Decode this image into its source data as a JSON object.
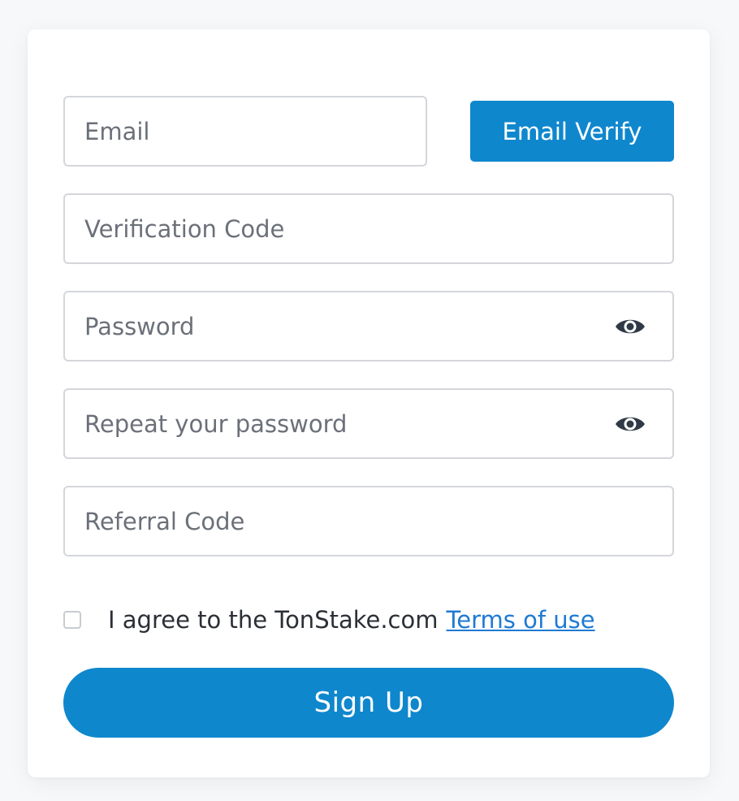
{
  "form": {
    "email": {
      "value": "",
      "placeholder": "Email"
    },
    "email_verify_label": "Email Verify",
    "verification_code": {
      "value": "",
      "placeholder": "Verification Code"
    },
    "password": {
      "value": "",
      "placeholder": "Password"
    },
    "repeat_password": {
      "value": "",
      "placeholder": "Repeat your password"
    },
    "referral_code": {
      "value": "",
      "placeholder": "Referral Code"
    },
    "agree_text": "I agree to the TonStake.com",
    "terms_link_label": "Terms of use",
    "agree_checked": false,
    "signup_label": "Sign Up"
  },
  "icons": {
    "password_toggle": "eye-icon",
    "repeat_password_toggle": "eye-icon"
  },
  "colors": {
    "primary": "#0f87cd",
    "link": "#1f7ad3",
    "input_border": "#d4d6da",
    "placeholder": "#6b7079",
    "icon": "#2f3a46"
  }
}
